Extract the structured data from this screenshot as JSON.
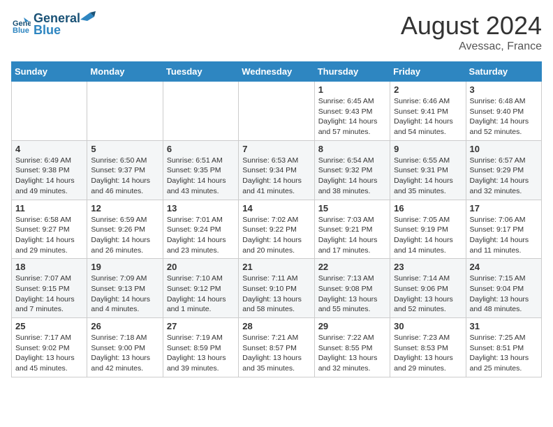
{
  "header": {
    "logo_line1": "General",
    "logo_line2": "Blue",
    "month_year": "August 2024",
    "location": "Avessac, France"
  },
  "days_of_week": [
    "Sunday",
    "Monday",
    "Tuesday",
    "Wednesday",
    "Thursday",
    "Friday",
    "Saturday"
  ],
  "weeks": [
    [
      {
        "day": "",
        "info": ""
      },
      {
        "day": "",
        "info": ""
      },
      {
        "day": "",
        "info": ""
      },
      {
        "day": "",
        "info": ""
      },
      {
        "day": "1",
        "info": "Sunrise: 6:45 AM\nSunset: 9:43 PM\nDaylight: 14 hours\nand 57 minutes."
      },
      {
        "day": "2",
        "info": "Sunrise: 6:46 AM\nSunset: 9:41 PM\nDaylight: 14 hours\nand 54 minutes."
      },
      {
        "day": "3",
        "info": "Sunrise: 6:48 AM\nSunset: 9:40 PM\nDaylight: 14 hours\nand 52 minutes."
      }
    ],
    [
      {
        "day": "4",
        "info": "Sunrise: 6:49 AM\nSunset: 9:38 PM\nDaylight: 14 hours\nand 49 minutes."
      },
      {
        "day": "5",
        "info": "Sunrise: 6:50 AM\nSunset: 9:37 PM\nDaylight: 14 hours\nand 46 minutes."
      },
      {
        "day": "6",
        "info": "Sunrise: 6:51 AM\nSunset: 9:35 PM\nDaylight: 14 hours\nand 43 minutes."
      },
      {
        "day": "7",
        "info": "Sunrise: 6:53 AM\nSunset: 9:34 PM\nDaylight: 14 hours\nand 41 minutes."
      },
      {
        "day": "8",
        "info": "Sunrise: 6:54 AM\nSunset: 9:32 PM\nDaylight: 14 hours\nand 38 minutes."
      },
      {
        "day": "9",
        "info": "Sunrise: 6:55 AM\nSunset: 9:31 PM\nDaylight: 14 hours\nand 35 minutes."
      },
      {
        "day": "10",
        "info": "Sunrise: 6:57 AM\nSunset: 9:29 PM\nDaylight: 14 hours\nand 32 minutes."
      }
    ],
    [
      {
        "day": "11",
        "info": "Sunrise: 6:58 AM\nSunset: 9:27 PM\nDaylight: 14 hours\nand 29 minutes."
      },
      {
        "day": "12",
        "info": "Sunrise: 6:59 AM\nSunset: 9:26 PM\nDaylight: 14 hours\nand 26 minutes."
      },
      {
        "day": "13",
        "info": "Sunrise: 7:01 AM\nSunset: 9:24 PM\nDaylight: 14 hours\nand 23 minutes."
      },
      {
        "day": "14",
        "info": "Sunrise: 7:02 AM\nSunset: 9:22 PM\nDaylight: 14 hours\nand 20 minutes."
      },
      {
        "day": "15",
        "info": "Sunrise: 7:03 AM\nSunset: 9:21 PM\nDaylight: 14 hours\nand 17 minutes."
      },
      {
        "day": "16",
        "info": "Sunrise: 7:05 AM\nSunset: 9:19 PM\nDaylight: 14 hours\nand 14 minutes."
      },
      {
        "day": "17",
        "info": "Sunrise: 7:06 AM\nSunset: 9:17 PM\nDaylight: 14 hours\nand 11 minutes."
      }
    ],
    [
      {
        "day": "18",
        "info": "Sunrise: 7:07 AM\nSunset: 9:15 PM\nDaylight: 14 hours\nand 7 minutes."
      },
      {
        "day": "19",
        "info": "Sunrise: 7:09 AM\nSunset: 9:13 PM\nDaylight: 14 hours\nand 4 minutes."
      },
      {
        "day": "20",
        "info": "Sunrise: 7:10 AM\nSunset: 9:12 PM\nDaylight: 14 hours\nand 1 minute."
      },
      {
        "day": "21",
        "info": "Sunrise: 7:11 AM\nSunset: 9:10 PM\nDaylight: 13 hours\nand 58 minutes."
      },
      {
        "day": "22",
        "info": "Sunrise: 7:13 AM\nSunset: 9:08 PM\nDaylight: 13 hours\nand 55 minutes."
      },
      {
        "day": "23",
        "info": "Sunrise: 7:14 AM\nSunset: 9:06 PM\nDaylight: 13 hours\nand 52 minutes."
      },
      {
        "day": "24",
        "info": "Sunrise: 7:15 AM\nSunset: 9:04 PM\nDaylight: 13 hours\nand 48 minutes."
      }
    ],
    [
      {
        "day": "25",
        "info": "Sunrise: 7:17 AM\nSunset: 9:02 PM\nDaylight: 13 hours\nand 45 minutes."
      },
      {
        "day": "26",
        "info": "Sunrise: 7:18 AM\nSunset: 9:00 PM\nDaylight: 13 hours\nand 42 minutes."
      },
      {
        "day": "27",
        "info": "Sunrise: 7:19 AM\nSunset: 8:59 PM\nDaylight: 13 hours\nand 39 minutes."
      },
      {
        "day": "28",
        "info": "Sunrise: 7:21 AM\nSunset: 8:57 PM\nDaylight: 13 hours\nand 35 minutes."
      },
      {
        "day": "29",
        "info": "Sunrise: 7:22 AM\nSunset: 8:55 PM\nDaylight: 13 hours\nand 32 minutes."
      },
      {
        "day": "30",
        "info": "Sunrise: 7:23 AM\nSunset: 8:53 PM\nDaylight: 13 hours\nand 29 minutes."
      },
      {
        "day": "31",
        "info": "Sunrise: 7:25 AM\nSunset: 8:51 PM\nDaylight: 13 hours\nand 25 minutes."
      }
    ]
  ]
}
